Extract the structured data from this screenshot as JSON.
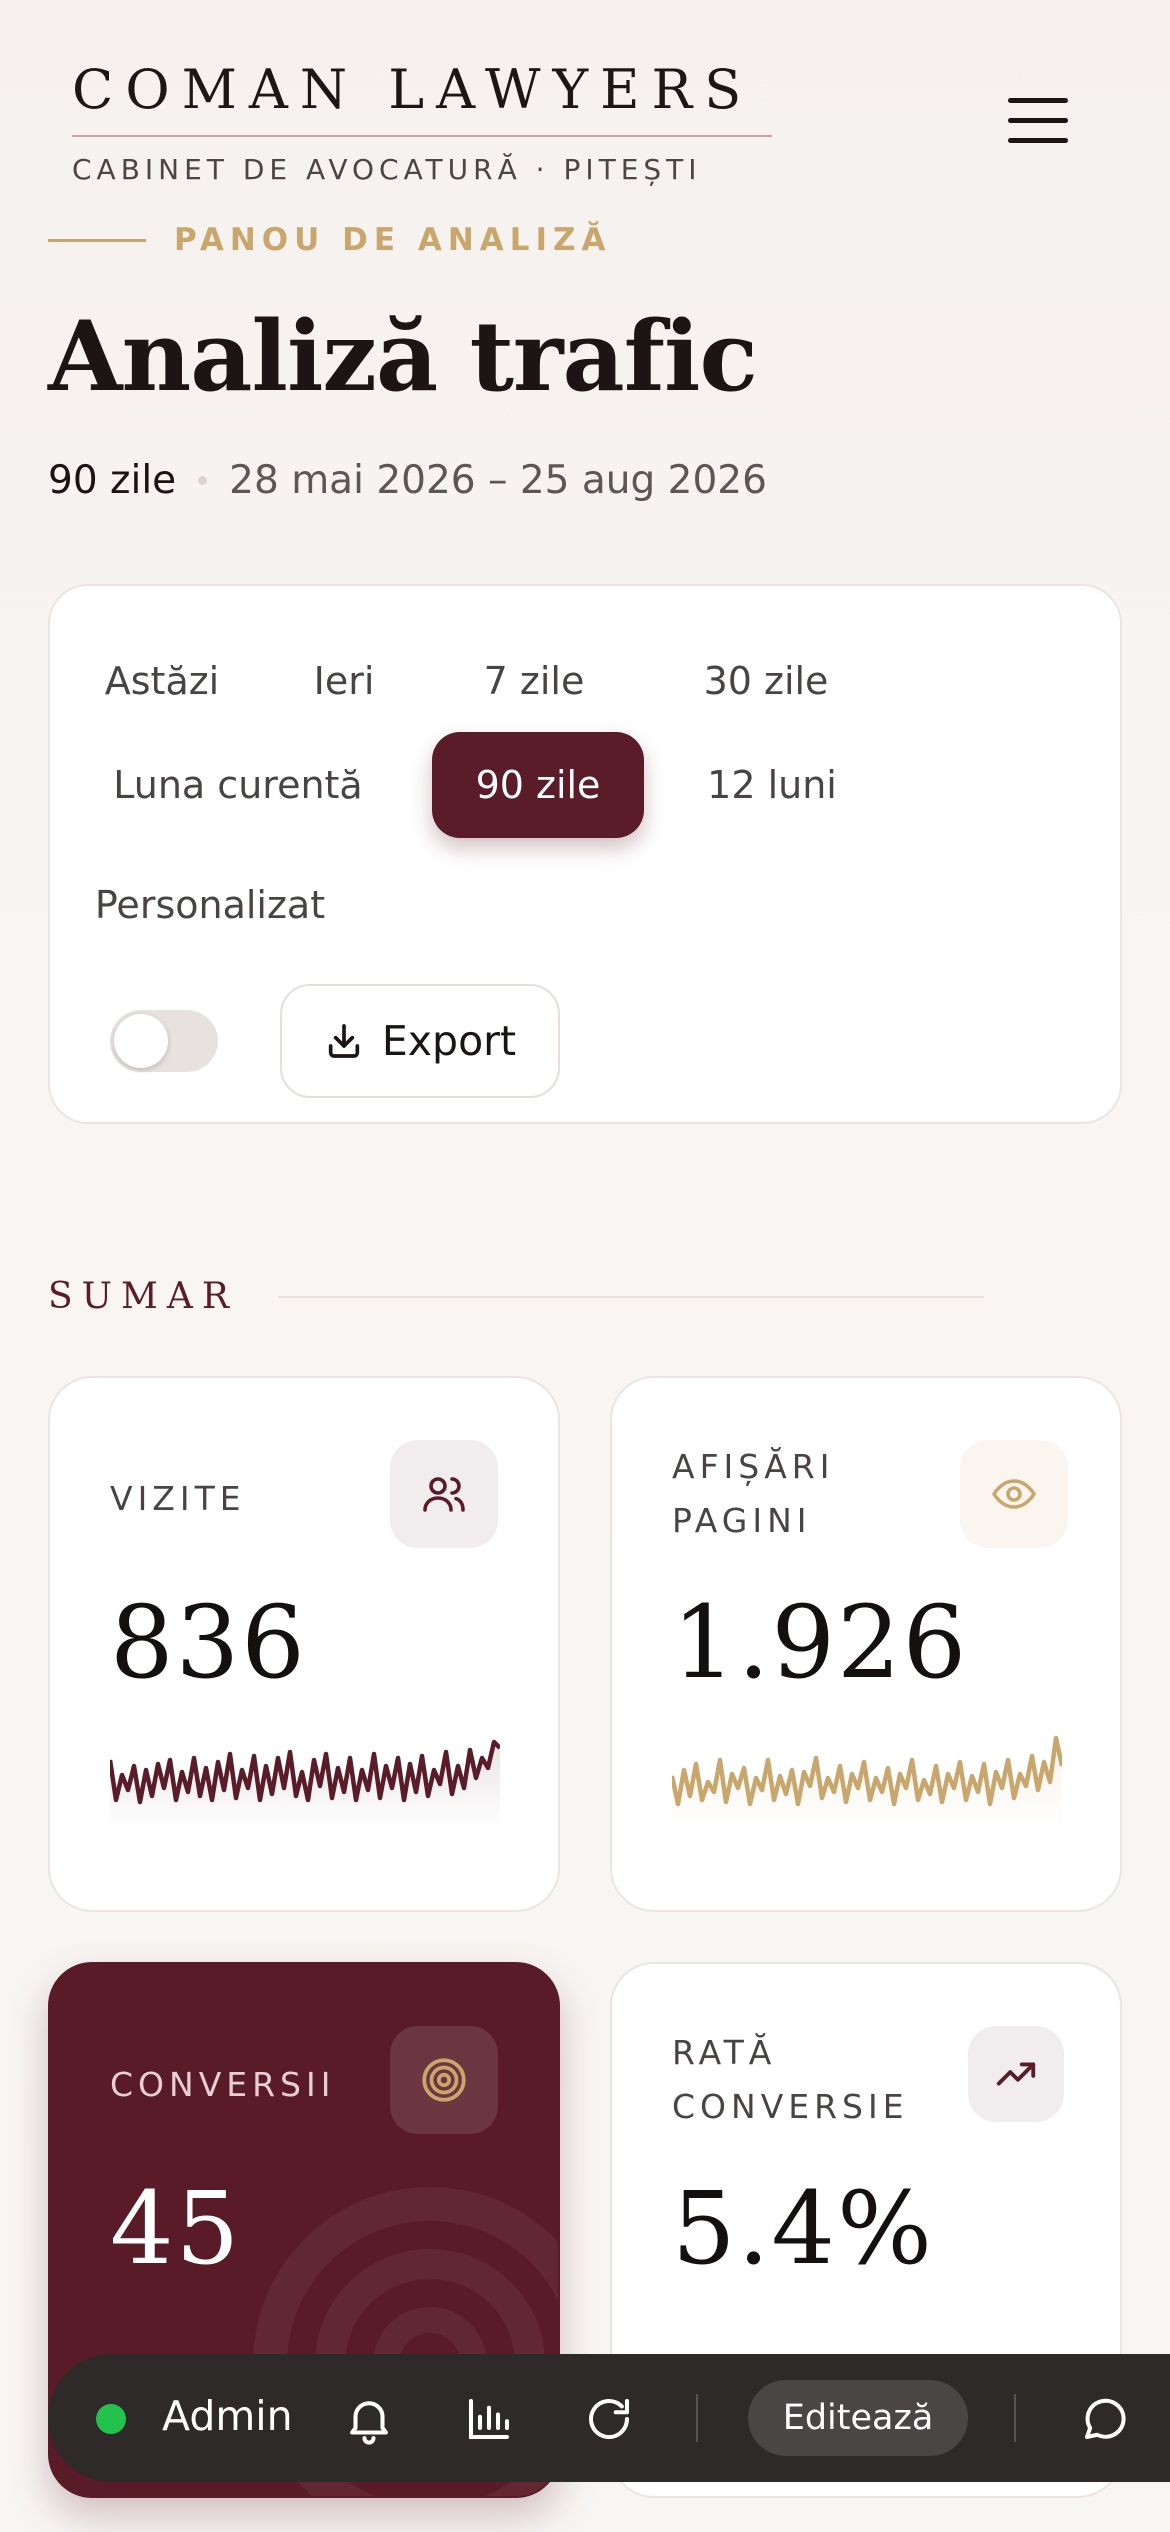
{
  "brand": {
    "name": "COMAN LAWYERS",
    "subtitle": "CABINET DE AVOCATURĂ · PITEȘTI"
  },
  "header": {
    "eyebrow": "PANOU DE ANALIZĂ",
    "title": "Analiză trafic",
    "period": "90 zile",
    "date_range": "28 mai 2026 – 25 aug 2026"
  },
  "filters": {
    "options": [
      "Astăzi",
      "Ieri",
      "7 zile",
      "30 zile",
      "Luna curentă",
      "90 zile",
      "12 luni",
      "Personalizat"
    ],
    "selected": "90 zile",
    "compare_toggle_on": false,
    "export_label": "Export"
  },
  "summary": {
    "heading": "SUMAR",
    "cards": [
      {
        "label": "VIZITE",
        "value": "836",
        "icon": "users-icon",
        "accent": "#5a1c28"
      },
      {
        "label": "AFIȘĂRI PAGINI",
        "value": "1.926",
        "icon": "eye-icon",
        "accent": "#c9a76c"
      },
      {
        "label": "CONVERSII",
        "value": "45",
        "icon": "target-icon",
        "accent": "#c9a76c"
      },
      {
        "label": "RATĂ CONVERSIE",
        "value": "5.4%",
        "icon": "trending-up-icon",
        "accent": "#5a1c28"
      }
    ]
  },
  "admin_bar": {
    "user": "Admin",
    "status_color": "#22c24d",
    "edit_label": "Editează"
  },
  "colors": {
    "brand": "#5a1c28",
    "gold": "#c9a76c",
    "background": "#f7f3f1"
  }
}
